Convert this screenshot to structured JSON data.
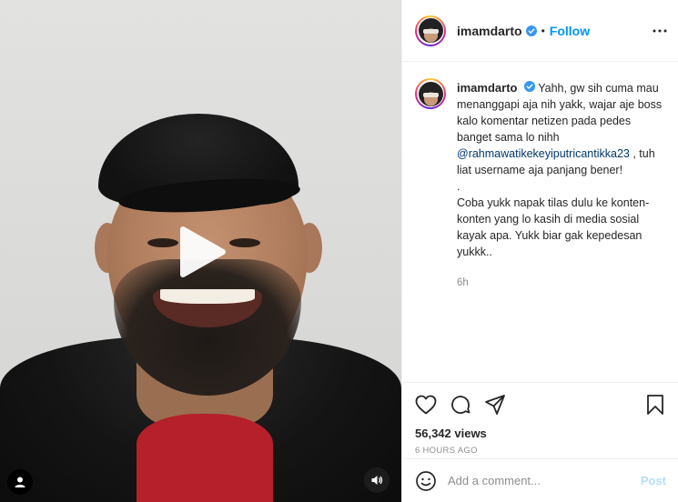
{
  "post": {
    "username": "imamdarto",
    "dot": "•",
    "follow_label": "Follow",
    "more_icon": "more-horizontal-icon",
    "caption": {
      "username": "imamdarto",
      "text_before_mention": "Yahh, gw sih cuma mau menanggapi aja nih yakk, wajar aje boss kalo komentar netizen pada pedes banget sama lo nihh",
      "mention": "@rahmawatikekeyiputricantikka23",
      "text_after_mention": ", tuh liat username aja panjang bener!",
      "line_dot": ".",
      "paragraph2": "Coba yukk napak tilas dulu ke konten-konten yang lo kasih di media sosial kayak apa. Yukk biar gak kepedesan yukkk..",
      "time": "6h"
    },
    "actions": {
      "like_icon": "heart-icon",
      "comment_icon": "comment-icon",
      "share_icon": "share-icon",
      "save_icon": "bookmark-icon"
    },
    "views": "56,342 views",
    "posted_ago": "6 HOURS AGO",
    "comment": {
      "placeholder": "Add a comment...",
      "post_label": "Post",
      "emoji_icon": "emoji-icon"
    }
  },
  "video": {
    "play_icon": "play-icon",
    "sound_icon": "sound-icon",
    "account_icon": "user-badge-icon"
  }
}
